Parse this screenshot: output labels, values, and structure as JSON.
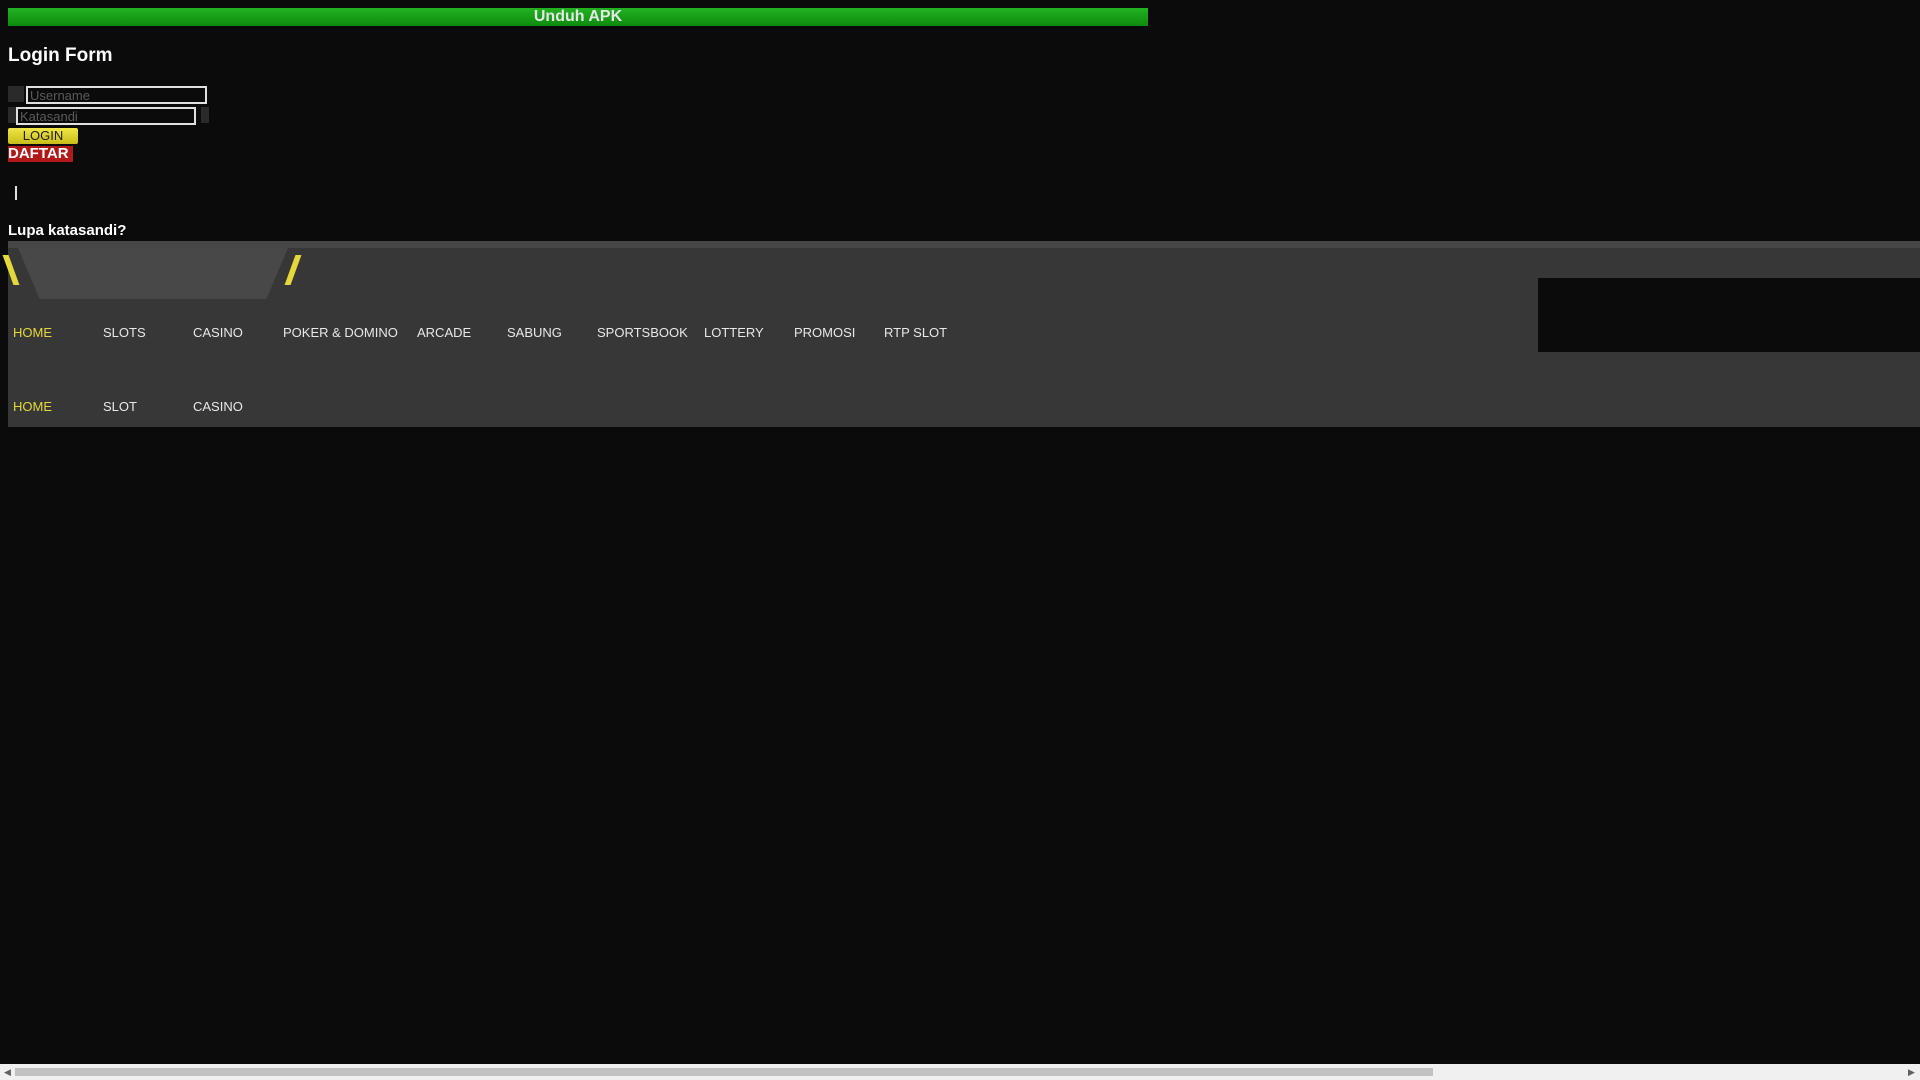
{
  "download_bar": {
    "label": "Unduh APK"
  },
  "login_form": {
    "title": "Login Form",
    "username_placeholder": "Username",
    "password_placeholder": "Katasandi",
    "login_label": "LOGIN",
    "register_label": "DAFTAR",
    "forgot_label": "Lupa katasandi?"
  },
  "nav": {
    "primary": [
      "HOME",
      "SLOTS",
      "CASINO",
      "POKER & DOMINO",
      "ARCADE",
      "SABUNG",
      "SPORTSBOOK",
      "LOTTERY",
      "PROMOSI",
      "RTP SLOT"
    ],
    "secondary": [
      "HOME",
      "SLOT",
      "CASINO"
    ],
    "active_label": "HOME"
  },
  "colors": {
    "accent_yellow": "#e5d83a",
    "download_green": "#16a016",
    "register_red": "#b11818",
    "header_gray": "#373737",
    "background": "#0b0b0b"
  }
}
